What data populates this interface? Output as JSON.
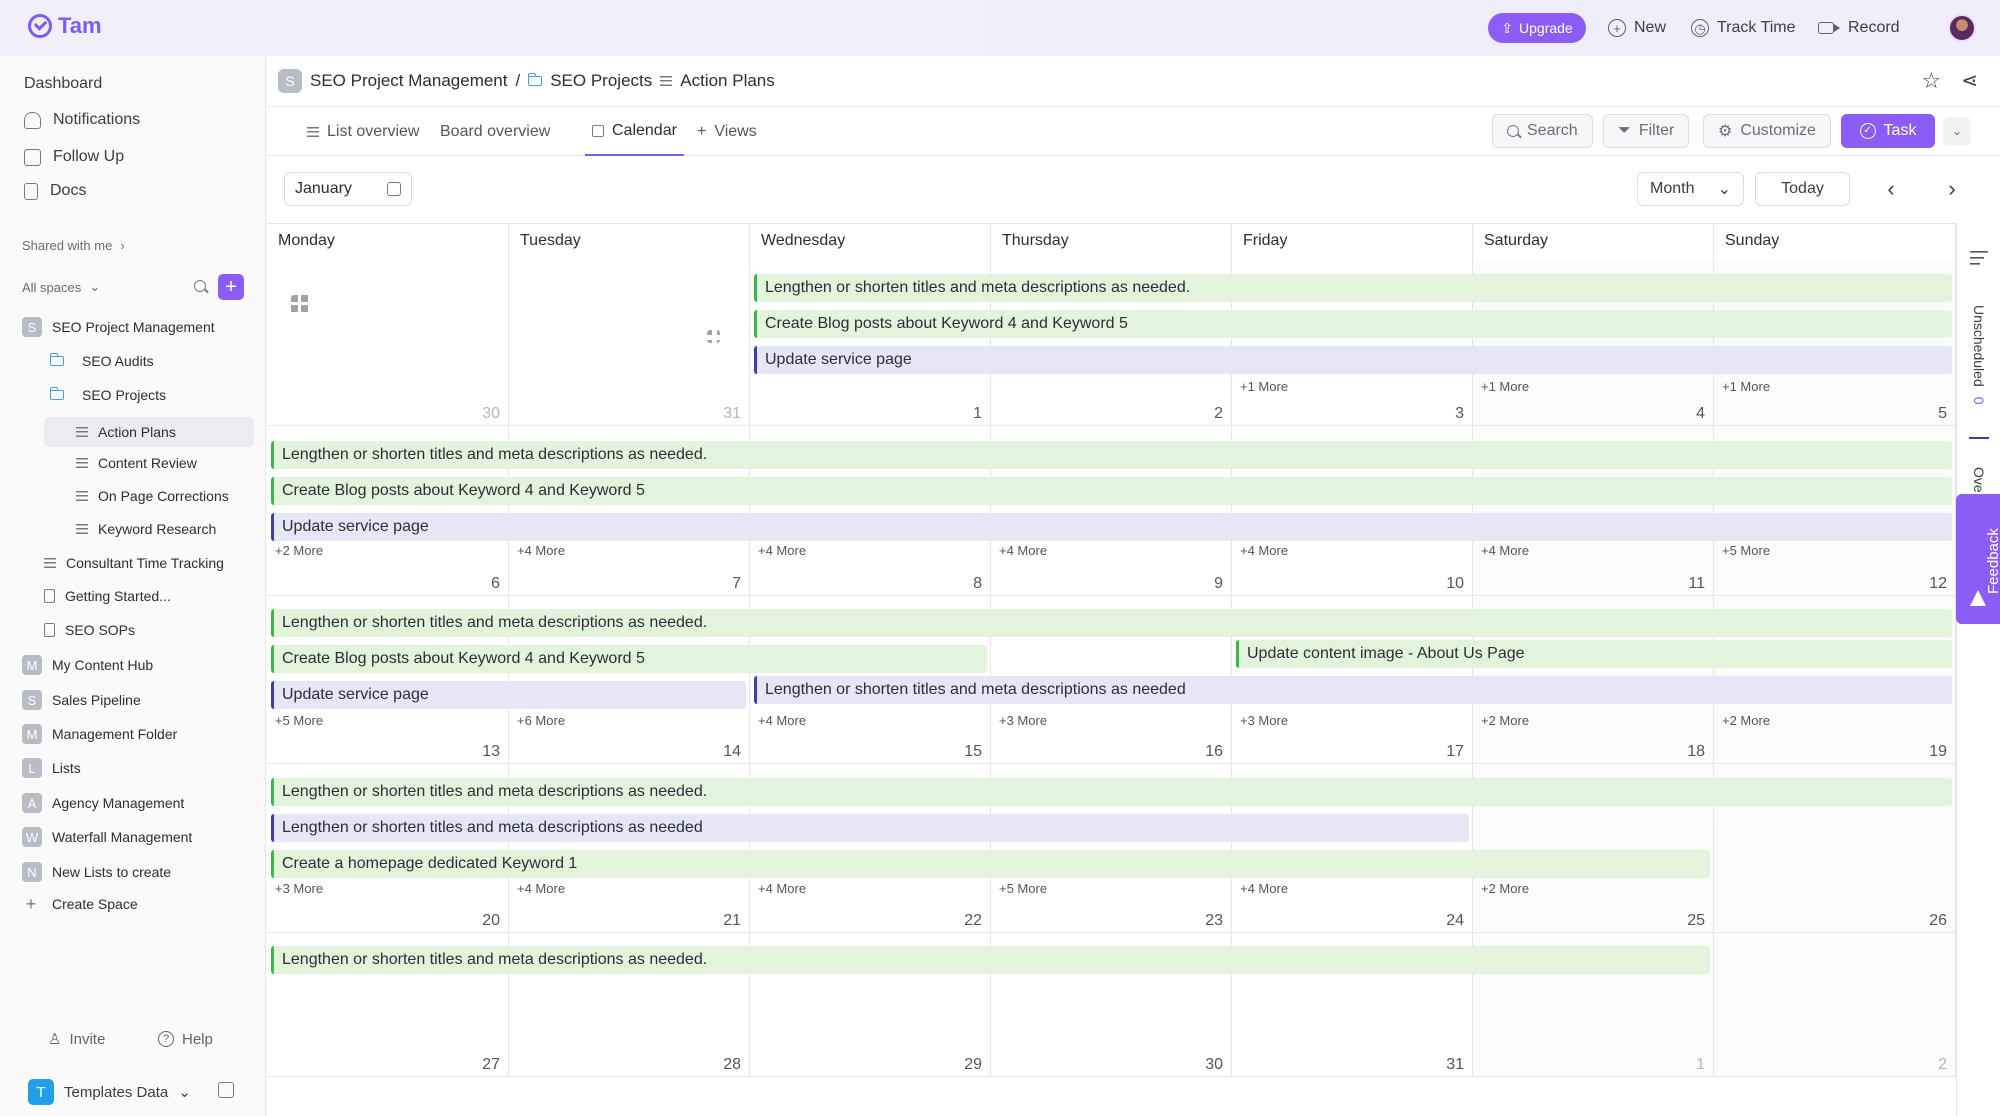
{
  "topbar": {
    "logo": "Tam",
    "upgrade": "Upgrade",
    "new": "New",
    "track_time": "Track Time",
    "record": "Record"
  },
  "sidebar": {
    "nav": [
      "Dashboard",
      "Notifications",
      "Follow Up",
      "Docs"
    ],
    "shared": "Shared with me",
    "all_spaces": "All spaces",
    "tree": [
      {
        "label": "SEO Project Management",
        "badge": "S"
      },
      {
        "label": "SEO Audits"
      },
      {
        "label": "SEO Projects"
      },
      {
        "label": "Action Plans"
      },
      {
        "label": "Content Review"
      },
      {
        "label": "On Page Corrections"
      },
      {
        "label": "Keyword Research"
      },
      {
        "label": "Consultant Time Tracking"
      },
      {
        "label": "Getting Started..."
      },
      {
        "label": "SEO SOPs"
      },
      {
        "label": "My Content Hub",
        "badge": "M"
      },
      {
        "label": "Sales Pipeline",
        "badge": "S"
      },
      {
        "label": "Management Folder",
        "badge": "M"
      },
      {
        "label": "Lists",
        "badge": "L"
      },
      {
        "label": "Agency Management",
        "badge": "A"
      },
      {
        "label": "Waterfall Management",
        "badge": "W"
      },
      {
        "label": "New Lists to create",
        "badge": "N"
      },
      {
        "label": "Create Space"
      }
    ],
    "invite": "Invite",
    "help": "Help",
    "workspace": {
      "badge": "T",
      "name": "Templates Data"
    }
  },
  "breadcrumb": {
    "badge": "S",
    "space": "SEO Project Management",
    "sep": "/",
    "folder": "SEO Projects",
    "list": "Action Plans"
  },
  "tabs": [
    "List overview",
    "Board overview",
    "Calendar",
    "Views"
  ],
  "tools": {
    "search": "Search",
    "filter": "Filter",
    "customize": "Customize",
    "task": "Task"
  },
  "calendar": {
    "month": "January",
    "view": "Month",
    "today": "Today",
    "days": [
      "Monday",
      "Tuesday",
      "Wednesday",
      "Thursday",
      "Friday",
      "Saturday",
      "Sunday"
    ],
    "weeks": [
      {
        "dates": [
          "30",
          "31",
          "1",
          "2",
          "3",
          "4",
          "5"
        ],
        "dim": [
          0,
          1
        ]
      },
      {
        "dates": [
          "6",
          "7",
          "8",
          "9",
          "10",
          "11",
          "12"
        ],
        "dim": []
      },
      {
        "dates": [
          "13",
          "14",
          "15",
          "16",
          "17",
          "18",
          "19"
        ],
        "dim": []
      },
      {
        "dates": [
          "20",
          "21",
          "22",
          "23",
          "24",
          "25",
          "26"
        ],
        "dim": []
      },
      {
        "dates": [
          "27",
          "28",
          "29",
          "30",
          "31",
          "1",
          "2"
        ],
        "dim": [
          5,
          6
        ]
      }
    ],
    "more": [
      [
        "",
        "",
        "",
        "",
        "+1 More",
        "+1 More",
        "+1 More"
      ],
      [
        "+2 More",
        "+4 More",
        "+4 More",
        "+4 More",
        "+4 More",
        "+4 More",
        "+5 More"
      ],
      [
        "+5 More",
        "+6 More",
        "+4 More",
        "+3 More",
        "+3 More",
        "+2 More",
        "+2 More"
      ],
      [
        "+3 More",
        "+4 More",
        "+4 More",
        "+5 More",
        "+4 More",
        "+2 More",
        ""
      ],
      [
        "",
        "",
        "",
        "",
        "",
        "",
        ""
      ]
    ],
    "events": [
      {
        "week": 0,
        "row": 0,
        "start": 2,
        "span": 5,
        "color": "green",
        "title": "Lengthen or shorten titles and meta descriptions as needed."
      },
      {
        "week": 0,
        "row": 1,
        "start": 2,
        "span": 5,
        "color": "green",
        "title": "Create Blog posts about Keyword 4 and Keyword 5"
      },
      {
        "week": 0,
        "row": 2,
        "start": 2,
        "span": 5,
        "color": "blue",
        "title": "Update service page"
      },
      {
        "week": 1,
        "row": 0,
        "start": 0,
        "span": 7,
        "color": "green",
        "title": "Lengthen or shorten titles and meta descriptions as needed."
      },
      {
        "week": 1,
        "row": 1,
        "start": 0,
        "span": 7,
        "color": "green",
        "title": "Create Blog posts about Keyword 4 and Keyword 5"
      },
      {
        "week": 1,
        "row": 2,
        "start": 0,
        "span": 7,
        "color": "blue",
        "title": "Update service page"
      },
      {
        "week": 2,
        "row": 0,
        "start": 0,
        "span": 7,
        "color": "green",
        "title": "Lengthen or shorten titles and meta descriptions as needed."
      },
      {
        "week": 2,
        "row": 1,
        "start": 0,
        "span": 3,
        "color": "green",
        "title": "Create Blog posts about Keyword 4 and Keyword 5"
      },
      {
        "week": 2,
        "row": 0.85,
        "start": 4,
        "span": 3,
        "color": "green",
        "title": "Update content image - About Us Page"
      },
      {
        "week": 2,
        "row": 2,
        "start": 0,
        "span": 2,
        "color": "blue",
        "title": "Update service page"
      },
      {
        "week": 2,
        "row": 1.85,
        "start": 2,
        "span": 5,
        "color": "blue",
        "title": "Lengthen or shorten titles and meta descriptions as needed"
      },
      {
        "week": 3,
        "row": 0,
        "start": 0,
        "span": 7,
        "color": "green",
        "title": "Lengthen or shorten titles and meta descriptions as needed."
      },
      {
        "week": 3,
        "row": 1,
        "start": 0,
        "span": 5,
        "color": "blue",
        "title": "Lengthen or shorten titles and meta descriptions as needed"
      },
      {
        "week": 3,
        "row": 2,
        "start": 0,
        "span": 6,
        "color": "green",
        "title": "Create a homepage dedicated Keyword 1"
      },
      {
        "week": 4,
        "row": 0,
        "start": 0,
        "span": 6,
        "color": "green",
        "title": "Lengthen or shorten titles and meta descriptions as needed."
      }
    ]
  },
  "rail": {
    "unscheduled": "Unscheduled",
    "unscheduled_count": "0",
    "overdue": "Ove",
    "feedback": "Feedback"
  }
}
